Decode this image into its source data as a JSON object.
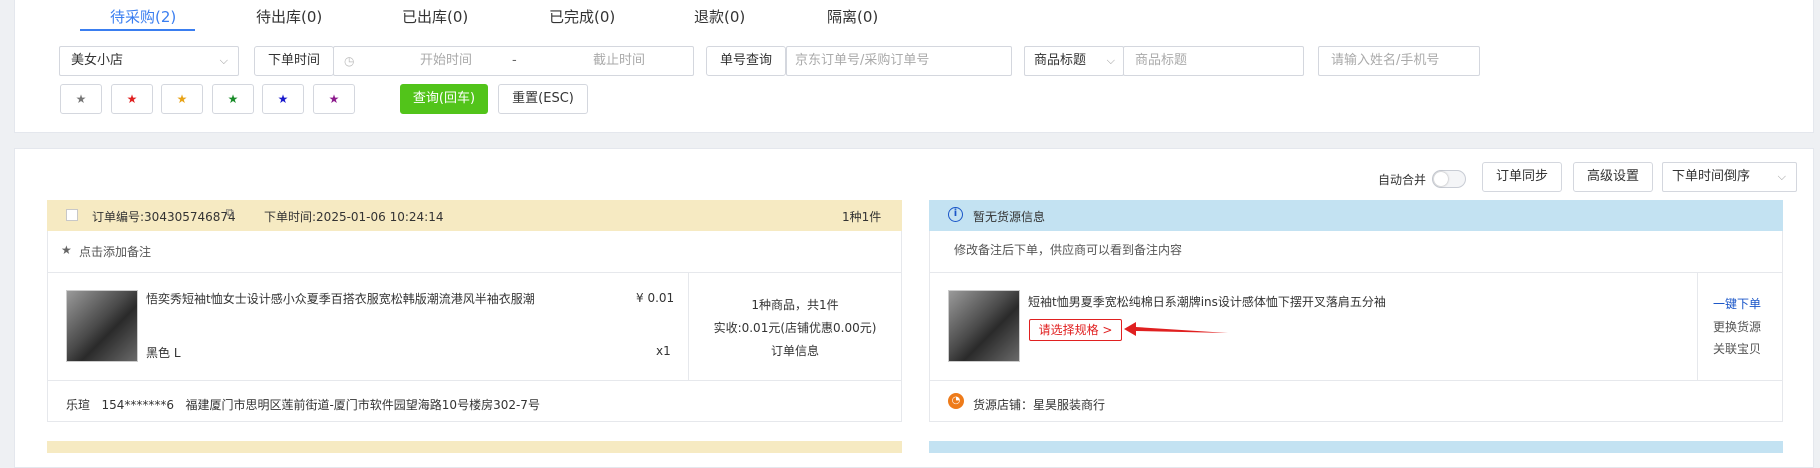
{
  "tabs": [
    {
      "label": "待采购(2)"
    },
    {
      "label": "待出库(0)"
    },
    {
      "label": "已出库(0)"
    },
    {
      "label": "已完成(0)"
    },
    {
      "label": "退款(0)"
    },
    {
      "label": "隔离(0)"
    }
  ],
  "filters": {
    "shop_value": "美女小店",
    "order_time_label": "下单时间",
    "start_placeholder": "开始时间",
    "date_separator": "-",
    "end_placeholder": "截止时间",
    "order_query_label": "单号查询",
    "order_query_placeholder": "京东订单号/采购订单号",
    "product_title_select": "商品标题",
    "product_title_placeholder": "商品标题",
    "name_phone_placeholder": "请输入姓名/手机号",
    "star_colors": [
      "#777777",
      "#e02020",
      "#e8a317",
      "#1a8c2a",
      "#1a1acc",
      "#8c1a8c"
    ],
    "star_glyph": "★",
    "query_button": "查询(回车)",
    "reset_button": "重置(ESC)",
    "query_button_color": "#52c41a"
  },
  "toolbar": {
    "auto_merge_label": "自动合并",
    "order_sync_button": "订单同步",
    "advanced_settings_button": "高级设置",
    "sort_value": "下单时间倒序"
  },
  "order": {
    "order_no": "订单编号:304305746874",
    "order_time": "下单时间:2025-01-06 10:24:14",
    "count_summary": "1种1件",
    "add_note": "点击添加备注",
    "product_title": "悟奕秀短袖t恤女士设计感小众夏季百搭衣服宽松韩版潮流港风半袖衣服潮",
    "price": "¥ 0.01",
    "spec": "黑色 L",
    "qty": "x1",
    "summary_line1": "1种商品，共1件",
    "summary_line2": "实收:0.01元(店铺优惠0.00元)",
    "order_info_link": "订单信息",
    "buyer_name": "乐瑄",
    "buyer_phone": "154*******6",
    "buyer_address": "福建厦门市思明区莲前街道-厦门市软件园望海路10号楼房302-7号"
  },
  "source": {
    "header": "暂无货源信息",
    "note": "修改备注后下单，供应商可以看到备注内容",
    "product_title": "短袖t恤男夏季宽松纯棉日系潮牌ins设计感体恤下摆开叉落肩五分袖",
    "select_spec_button": "请选择规格 >",
    "one_click_order": "一键下单",
    "change_source": "更换货源",
    "link_product": "关联宝贝",
    "store_label": "货源店铺：星昊服装商行"
  }
}
